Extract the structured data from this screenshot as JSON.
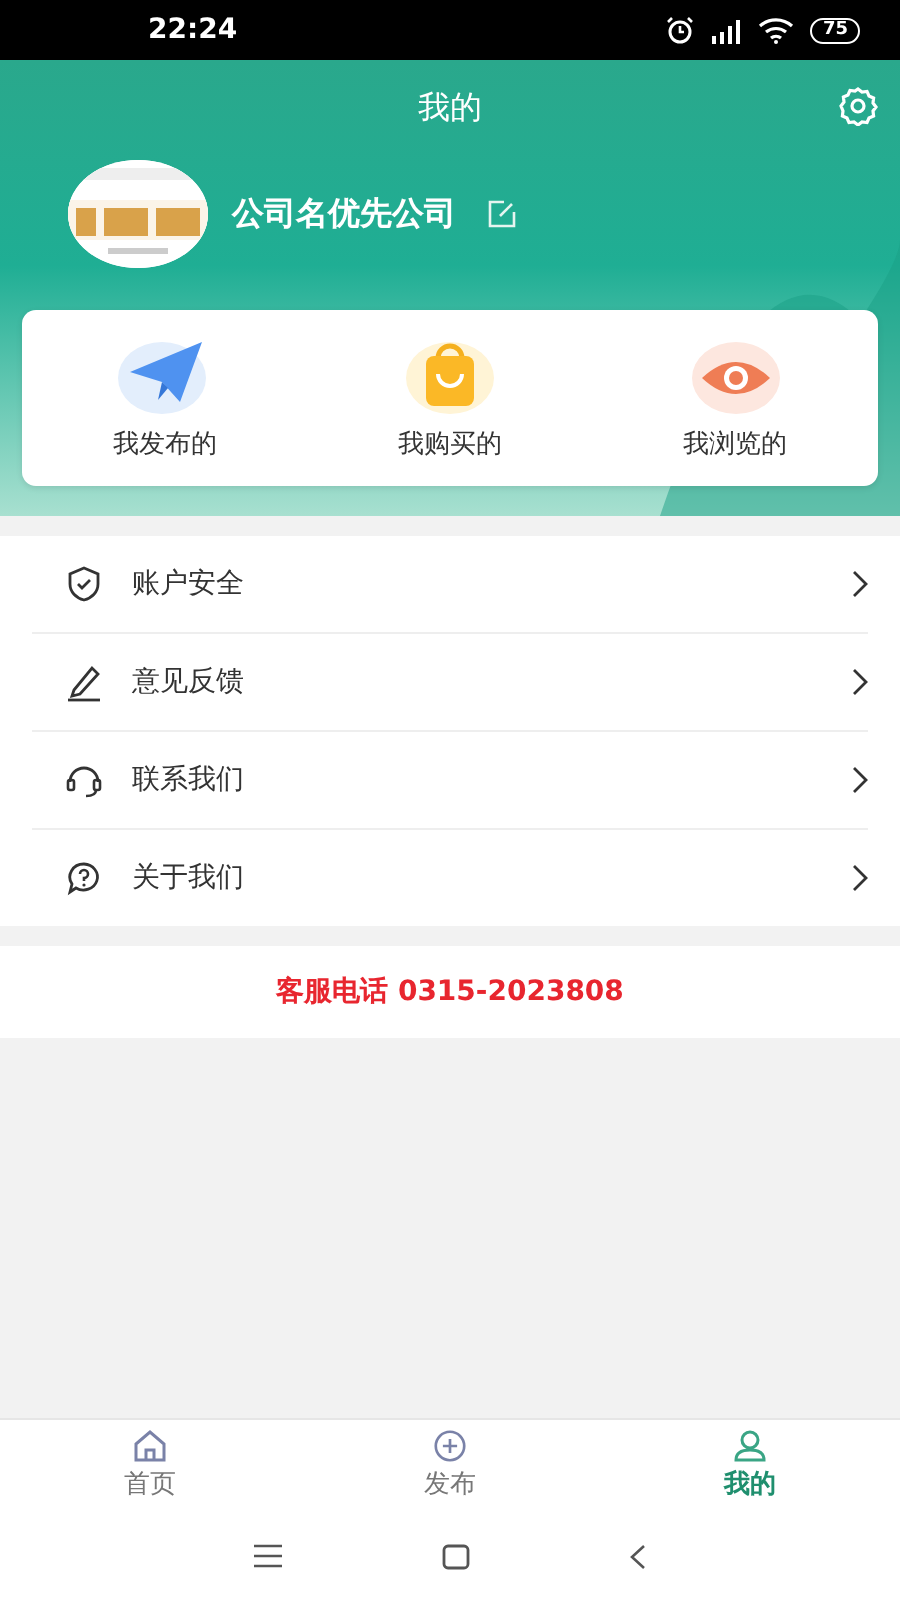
{
  "status_bar": {
    "time": "22:24",
    "battery": "75"
  },
  "header": {
    "title": "我的",
    "company": "公司名优先公司"
  },
  "shortcuts": [
    {
      "label": "我发布的"
    },
    {
      "label": "我购买的"
    },
    {
      "label": "我浏览的"
    }
  ],
  "menu": [
    {
      "label": "账户安全"
    },
    {
      "label": "意见反馈"
    },
    {
      "label": "联系我们"
    },
    {
      "label": "关于我们"
    }
  ],
  "service_phone": "客服电话 0315-2023808",
  "tab_bar": [
    {
      "label": "首页",
      "selected": false
    },
    {
      "label": "发布",
      "selected": false
    },
    {
      "label": "我的",
      "selected": true
    }
  ]
}
